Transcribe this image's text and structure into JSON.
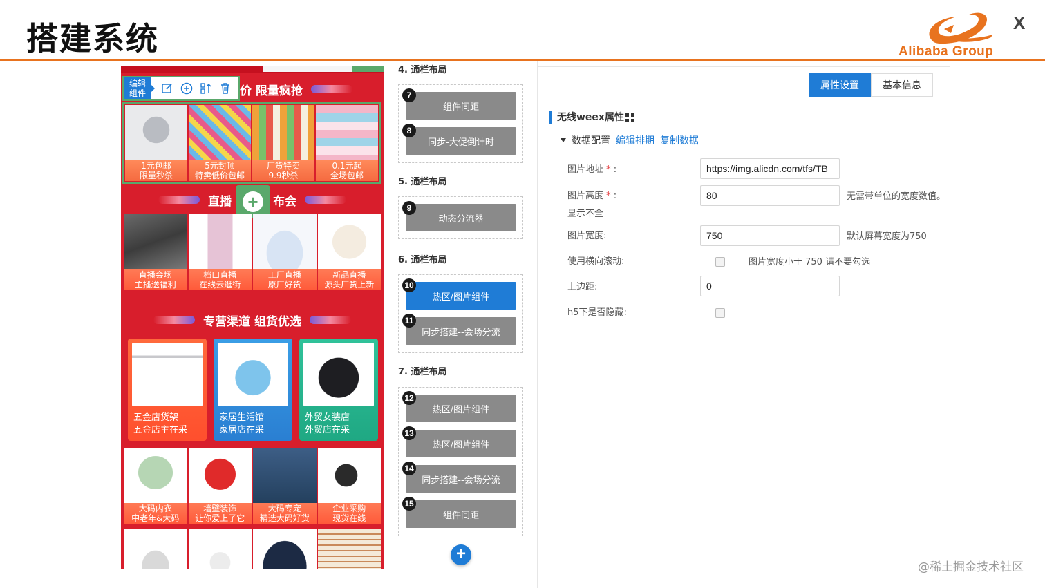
{
  "slide": {
    "title": "搭建系统",
    "brand": "Alibaba Group",
    "close_glyph": "X",
    "watermark": "@稀土掘金技术社区"
  },
  "colors": {
    "accent": "#1f7cd6",
    "brand_orange": "#e8731f",
    "preview_red": "#d81e2c",
    "selection_green": "#5aa86b",
    "component_gray": "#8a8a8a"
  },
  "preview": {
    "edit_label": "编辑组件",
    "toolbar_icons": [
      "edit-icon",
      "add-circle-icon",
      "sort-icon",
      "trash-icon"
    ],
    "banner1": "价 限量疯抢",
    "banner2_left": "直播",
    "banner2_right": "布会",
    "banner3": "专营渠道 组货优选",
    "row1": [
      {
        "line1": "1元包邮",
        "line2": "限量秒杀"
      },
      {
        "line1": "5元封顶",
        "line2": "特卖低价包邮"
      },
      {
        "line1": "厂货特卖",
        "line2": "9.9秒杀"
      },
      {
        "line1": "0.1元起",
        "line2": "全场包邮"
      }
    ],
    "row2": [
      {
        "line1": "直播会场",
        "line2": "主播送福利"
      },
      {
        "line1": "档口直播",
        "line2": "在线云逛街"
      },
      {
        "line1": "工厂直播",
        "line2": "原厂好货"
      },
      {
        "line1": "新品直播",
        "line2": "源头厂货上新"
      }
    ],
    "row3": [
      {
        "line1": "五金店货架",
        "line2": "五金店主在采"
      },
      {
        "line1": "家居生活馆",
        "line2": "家居店在采"
      },
      {
        "line1": "外贸女装店",
        "line2": "外贸店在采"
      }
    ],
    "row4": [
      {
        "line1": "大码内衣",
        "line2": "中老年&大码"
      },
      {
        "line1": "墙壁装饰",
        "line2": "让你爱上了它"
      },
      {
        "line1": "大码专宠",
        "line2": "精选大码好货"
      },
      {
        "line1": "企业采购",
        "line2": "现货在线"
      }
    ]
  },
  "layout_list": {
    "sections": [
      {
        "title": "4. 通栏布局"
      },
      {
        "title": "5. 通栏布局"
      },
      {
        "title": "6. 通栏布局"
      },
      {
        "title": "7. 通栏布局"
      }
    ],
    "components": [
      {
        "num": "7",
        "label": "组件间距",
        "active": false
      },
      {
        "num": "8",
        "label": "同步-大促倒计时",
        "active": false
      },
      {
        "num": "9",
        "label": "动态分流器",
        "active": false
      },
      {
        "num": "10",
        "label": "热区/图片组件",
        "active": true
      },
      {
        "num": "11",
        "label": "同步搭建--会场分流",
        "active": false
      },
      {
        "num": "12",
        "label": "热区/图片组件",
        "active": false
      },
      {
        "num": "13",
        "label": "热区/图片组件",
        "active": false
      },
      {
        "num": "14",
        "label": "同步搭建--会场分流",
        "active": false
      },
      {
        "num": "15",
        "label": "组件间距",
        "active": false
      }
    ],
    "add_glyph": "+"
  },
  "panel": {
    "tabs": [
      {
        "label": "属性设置",
        "active": true
      },
      {
        "label": "基本信息",
        "active": false
      }
    ],
    "title": "无线weex属性",
    "data_config": "数据配置",
    "edit_schedule": "编辑排期",
    "copy_data": "复制数据",
    "fields": {
      "img_url_label": "图片地址",
      "img_url_value": "https://img.alicdn.com/tfs/TB",
      "img_height_label": "图片高度",
      "img_height_value": "80",
      "img_height_hint": "无需带单位的宽度数值。",
      "img_height_note": "显示不全",
      "img_width_label": "图片宽度:",
      "img_width_value": "750",
      "img_width_hint": "默认屏幕宽度为750",
      "hscroll_label": "使用横向滚动:",
      "hscroll_hint": "图片宽度小于 750 请不要勾选",
      "margin_top_label": "上边距:",
      "margin_top_value": "0",
      "h5_hide_label": "h5下是否隐藏:"
    },
    "required_mark": "*"
  }
}
